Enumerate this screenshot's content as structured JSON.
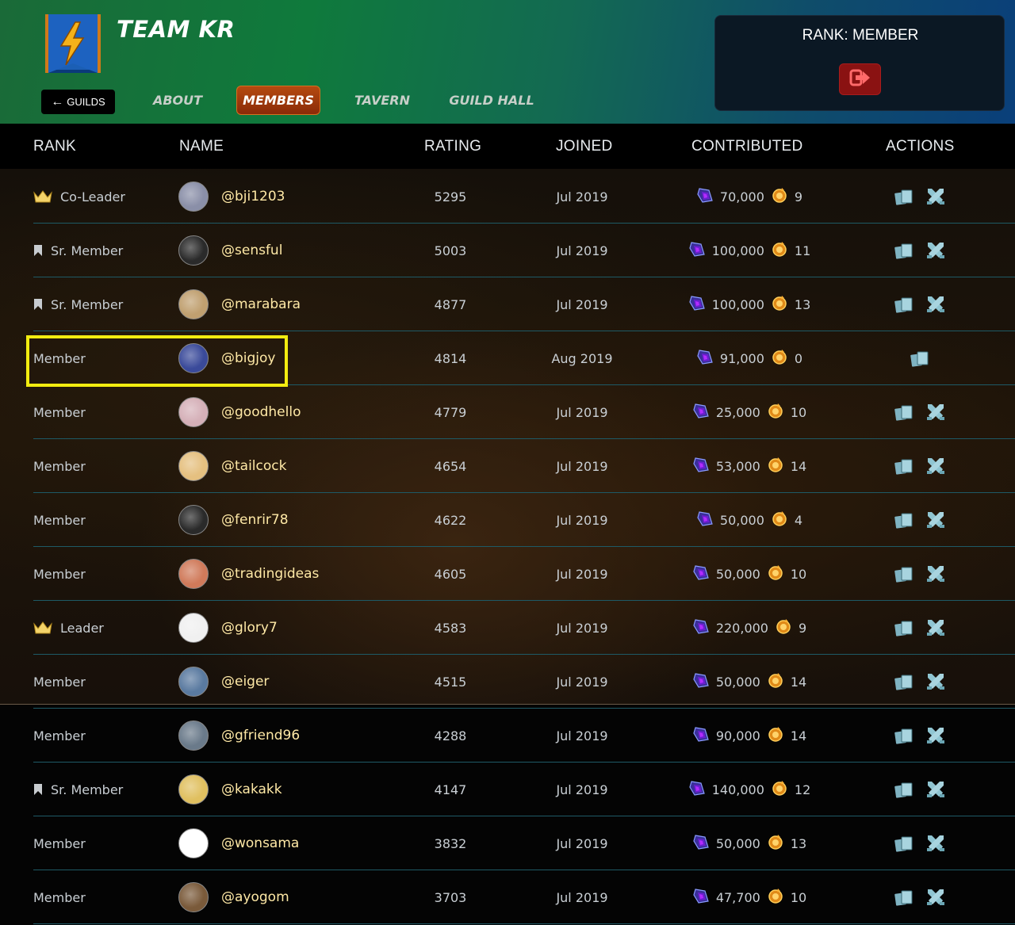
{
  "header": {
    "team_name": "TEAM KR",
    "guilds_button": "GUILDS",
    "tabs": [
      {
        "label": "ABOUT",
        "active": false
      },
      {
        "label": "MEMBERS",
        "active": true
      },
      {
        "label": "TAVERN",
        "active": false
      },
      {
        "label": "GUILD HALL",
        "active": false
      }
    ],
    "rank_prefix": "RANK: ",
    "rank_value": "MEMBER"
  },
  "columns": [
    "RANK",
    "NAME",
    "RATING",
    "JOINED",
    "CONTRIBUTED",
    "ACTIONS"
  ],
  "members": [
    {
      "rank": "Co-Leader",
      "rank_icon": "crown-icon",
      "name": "@bji1203",
      "rating": "5295",
      "joined": "Jul 2019",
      "gems": "70,000",
      "coins": "9",
      "actions": [
        "cards-icon",
        "battle-icon"
      ]
    },
    {
      "rank": "Sr. Member",
      "rank_icon": "bookmark-icon",
      "name": "@sensful",
      "rating": "5003",
      "joined": "Jul 2019",
      "gems": "100,000",
      "coins": "11",
      "actions": [
        "cards-icon",
        "battle-icon"
      ]
    },
    {
      "rank": "Sr. Member",
      "rank_icon": "bookmark-icon",
      "name": "@marabara",
      "rating": "4877",
      "joined": "Jul 2019",
      "gems": "100,000",
      "coins": "13",
      "actions": [
        "cards-icon",
        "battle-icon"
      ]
    },
    {
      "rank": "Member",
      "rank_icon": "",
      "name": "@bigjoy",
      "rating": "4814",
      "joined": "Aug 2019",
      "gems": "91,000",
      "coins": "0",
      "actions": [
        "cards-icon"
      ]
    },
    {
      "rank": "Member",
      "rank_icon": "",
      "name": "@goodhello",
      "rating": "4779",
      "joined": "Jul 2019",
      "gems": "25,000",
      "coins": "10",
      "actions": [
        "cards-icon",
        "battle-icon"
      ]
    },
    {
      "rank": "Member",
      "rank_icon": "",
      "name": "@tailcock",
      "rating": "4654",
      "joined": "Jul 2019",
      "gems": "53,000",
      "coins": "14",
      "actions": [
        "cards-icon",
        "battle-icon"
      ]
    },
    {
      "rank": "Member",
      "rank_icon": "",
      "name": "@fenrir78",
      "rating": "4622",
      "joined": "Jul 2019",
      "gems": "50,000",
      "coins": "4",
      "actions": [
        "cards-icon",
        "battle-icon"
      ]
    },
    {
      "rank": "Member",
      "rank_icon": "",
      "name": "@tradingideas",
      "rating": "4605",
      "joined": "Jul 2019",
      "gems": "50,000",
      "coins": "10",
      "actions": [
        "cards-icon",
        "battle-icon"
      ]
    },
    {
      "rank": "Leader",
      "rank_icon": "crown-icon",
      "name": "@glory7",
      "rating": "4583",
      "joined": "Jul 2019",
      "gems": "220,000",
      "coins": "9",
      "actions": [
        "cards-icon",
        "battle-icon"
      ]
    },
    {
      "rank": "Member",
      "rank_icon": "",
      "name": "@eiger",
      "rating": "4515",
      "joined": "Jul 2019",
      "gems": "50,000",
      "coins": "14",
      "actions": [
        "cards-icon",
        "battle-icon"
      ]
    },
    {
      "rank": "Member",
      "rank_icon": "",
      "name": "@gfriend96",
      "rating": "4288",
      "joined": "Jul 2019",
      "gems": "90,000",
      "coins": "14",
      "actions": [
        "cards-icon",
        "battle-icon"
      ]
    },
    {
      "rank": "Sr. Member",
      "rank_icon": "bookmark-icon",
      "name": "@kakakk",
      "rating": "4147",
      "joined": "Jul 2019",
      "gems": "140,000",
      "coins": "12",
      "actions": [
        "cards-icon",
        "battle-icon"
      ]
    },
    {
      "rank": "Member",
      "rank_icon": "",
      "name": "@wonsama",
      "rating": "3832",
      "joined": "Jul 2019",
      "gems": "50,000",
      "coins": "13",
      "actions": [
        "cards-icon",
        "battle-icon"
      ]
    },
    {
      "rank": "Member",
      "rank_icon": "",
      "name": "@ayogom",
      "rating": "3703",
      "joined": "Jul 2019",
      "gems": "47,700",
      "coins": "10",
      "actions": [
        "cards-icon",
        "battle-icon"
      ]
    }
  ],
  "colors": {
    "header_gradient_start": "#0f7a3c",
    "header_gradient_end": "#0a3f7a",
    "active_tab": "#b54a10",
    "leave_button": "#8a1212",
    "username": "#ffe9a6",
    "row_separator": "#1e5a66",
    "highlight_border": "#f2ec10"
  }
}
